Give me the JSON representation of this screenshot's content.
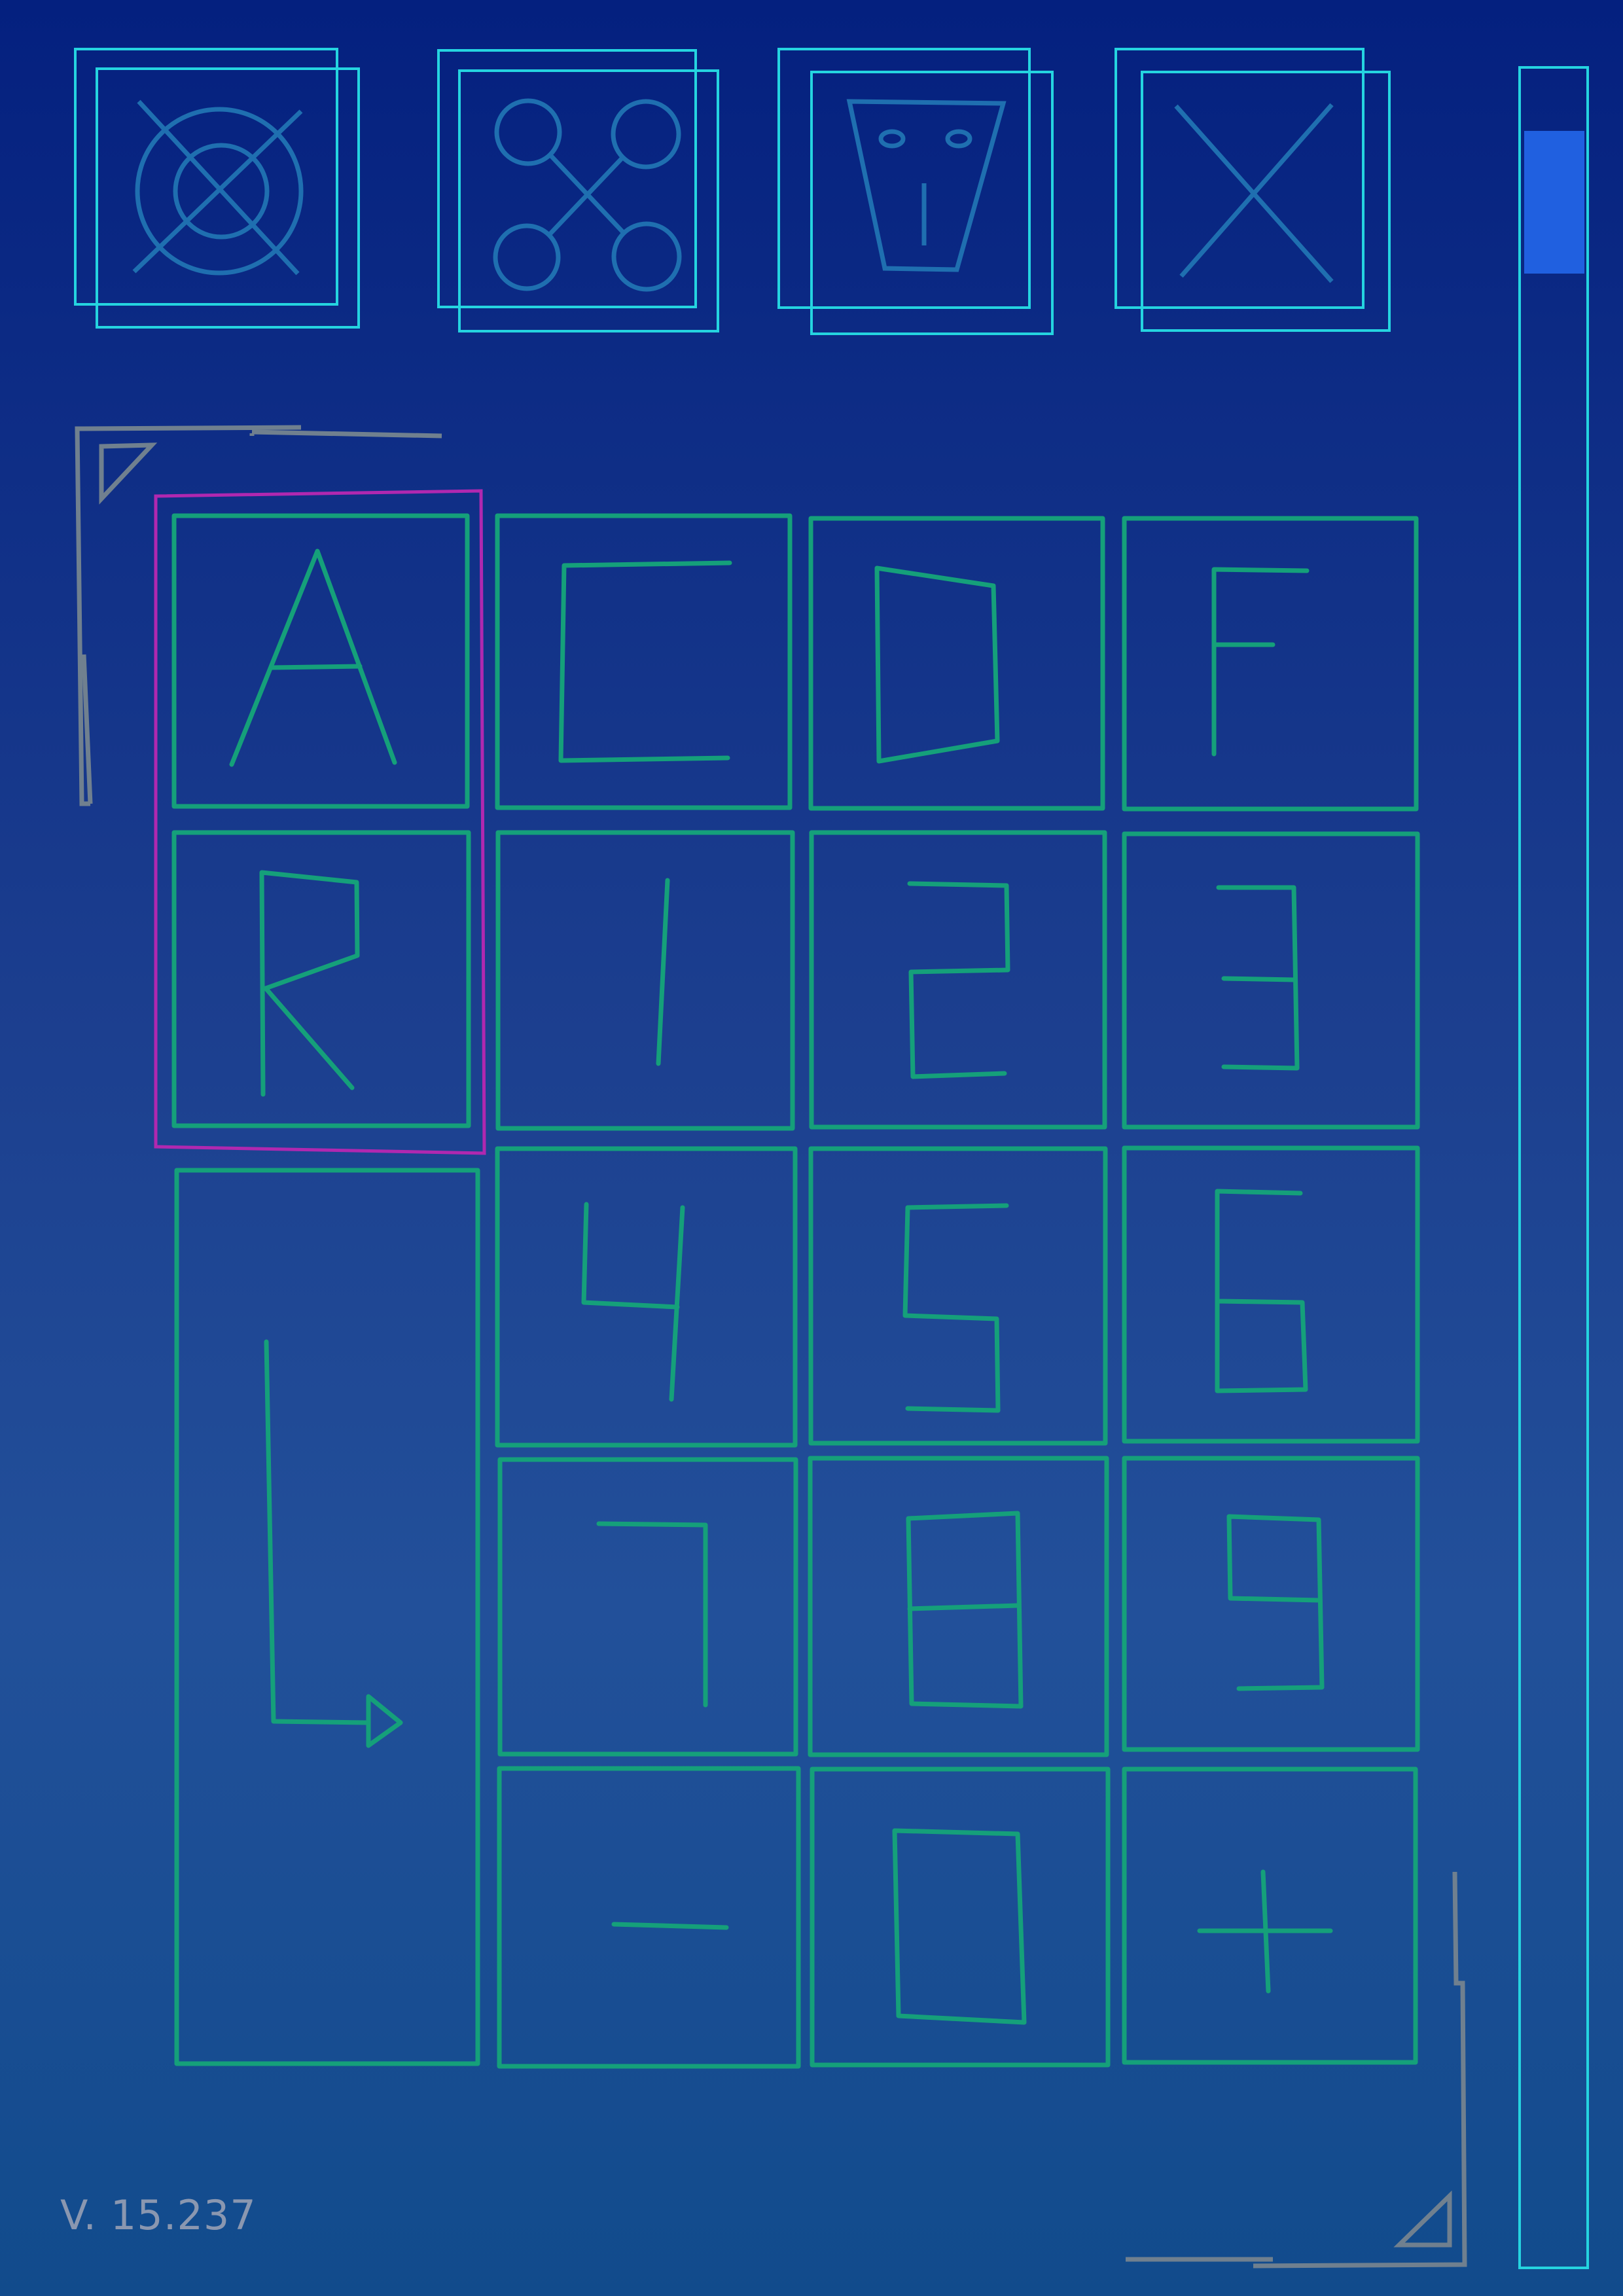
{
  "colors": {
    "toolbar_stroke": "#25d4e0",
    "icon_stroke": "#1f6fb0",
    "key_stroke": "#15a07a",
    "selection_stroke": "#b028b0",
    "corner_marker": "#70808f",
    "scroll_thumb": "#2060e0",
    "version_text": "#8a97b0"
  },
  "toolbar": [
    {
      "name": "target-cancel-icon"
    },
    {
      "name": "drone-icon"
    },
    {
      "name": "face-mask-icon"
    },
    {
      "name": "close-x-icon"
    }
  ],
  "keypad": {
    "letters": [
      "A",
      "C",
      "D",
      "F",
      "R"
    ],
    "digits": [
      "1",
      "2",
      "3",
      "4",
      "5",
      "6",
      "7",
      "8",
      "9",
      "0"
    ],
    "minus": "-",
    "plus": "+",
    "enter_icon": "enter-arrow-icon",
    "selected_key": "A"
  },
  "scrollbar": {
    "thumb_position": 0.03,
    "thumb_fraction": 0.065
  },
  "version": "V. 15.237"
}
